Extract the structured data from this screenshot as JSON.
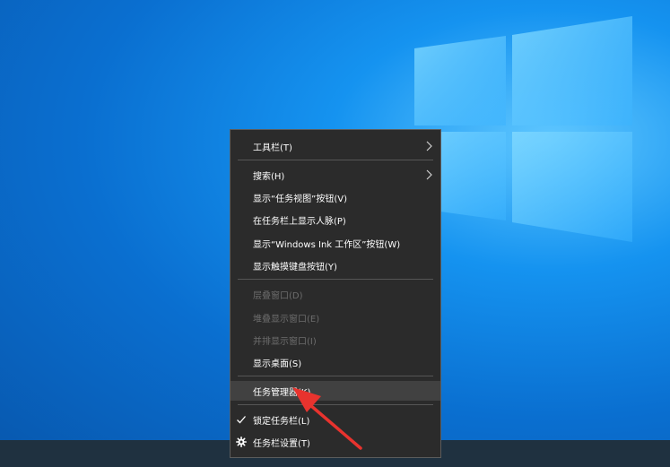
{
  "menu": {
    "items": [
      {
        "label": "工具栏(T)",
        "submenu": true,
        "enabled": true
      },
      {
        "label": "搜索(H)",
        "submenu": true,
        "enabled": true
      },
      {
        "label": "显示“任务视图”按钮(V)",
        "enabled": true
      },
      {
        "label": "在任务栏上显示人脉(P)",
        "enabled": true
      },
      {
        "label": "显示“Windows Ink 工作区”按钮(W)",
        "enabled": true
      },
      {
        "label": "显示触摸键盘按钮(Y)",
        "enabled": true
      },
      {
        "label": "层叠窗口(D)",
        "enabled": false
      },
      {
        "label": "堆叠显示窗口(E)",
        "enabled": false
      },
      {
        "label": "并排显示窗口(I)",
        "enabled": false
      },
      {
        "label": "显示桌面(S)",
        "enabled": true
      },
      {
        "label": "任务管理器(K)",
        "enabled": true,
        "highlighted": true
      },
      {
        "label": "锁定任务栏(L)",
        "enabled": true,
        "checked": true
      },
      {
        "label": "任务栏设置(T)",
        "enabled": true,
        "icon": "gear-icon"
      }
    ]
  },
  "colors": {
    "menu_background": "#2b2b2b",
    "highlight": "#414141",
    "disabled_text": "#6d6d6d",
    "annotation_arrow": "#e8332e"
  },
  "icons": {
    "submenu": "chevron-right-icon",
    "check": "checkmark-icon",
    "settings": "gear-icon"
  }
}
